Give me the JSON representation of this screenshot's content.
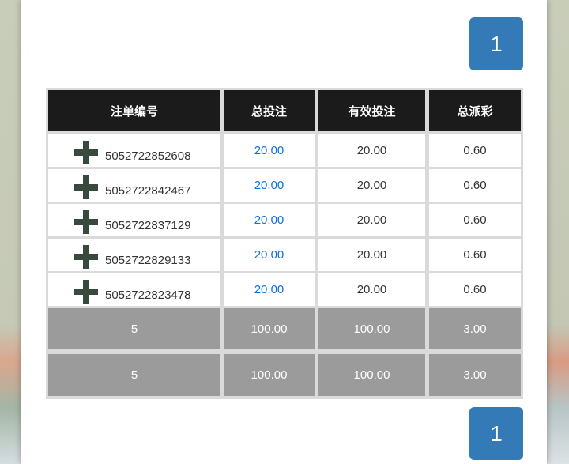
{
  "pagination": {
    "current_page_top": "1",
    "current_page_bottom": "1"
  },
  "table": {
    "headers": [
      "注单编号",
      "总投注",
      "有效投注",
      "总派彩"
    ],
    "rows": [
      {
        "id": "5052722852608",
        "total_bet": "20.00",
        "valid_bet": "20.00",
        "payout": "0.60"
      },
      {
        "id": "5052722842467",
        "total_bet": "20.00",
        "valid_bet": "20.00",
        "payout": "0.60"
      },
      {
        "id": "5052722837129",
        "total_bet": "20.00",
        "valid_bet": "20.00",
        "payout": "0.60"
      },
      {
        "id": "5052722829133",
        "total_bet": "20.00",
        "valid_bet": "20.00",
        "payout": "0.60"
      },
      {
        "id": "5052722823478",
        "total_bet": "20.00",
        "valid_bet": "20.00",
        "payout": "0.60"
      }
    ],
    "totals": [
      {
        "count": "5",
        "total_bet": "100.00",
        "valid_bet": "100.00",
        "payout": "3.00"
      },
      {
        "count": "5",
        "total_bet": "100.00",
        "valid_bet": "100.00",
        "payout": "3.00"
      }
    ]
  },
  "icons": {
    "expand_icon": "plus-icon"
  },
  "colors": {
    "pagination_bg": "#337ab7",
    "header_bg": "#1b1b1b",
    "total_bg": "#9b9b9b",
    "link_blue": "#0d6fd8"
  }
}
